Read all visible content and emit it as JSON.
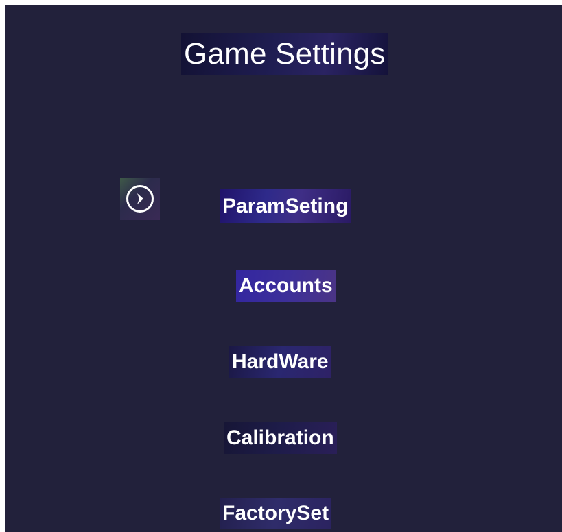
{
  "title": "Game Settings",
  "cursor_icon": "play-circle-icon",
  "selected_index": 0,
  "menu": [
    {
      "label": "ParamSeting"
    },
    {
      "label": "Accounts"
    },
    {
      "label": "HardWare"
    },
    {
      "label": "Calibration"
    },
    {
      "label": "FactorySet"
    }
  ],
  "colors": {
    "background": "#22213b",
    "text": "#ffffff",
    "label_highlight": "#2e2a8a"
  }
}
